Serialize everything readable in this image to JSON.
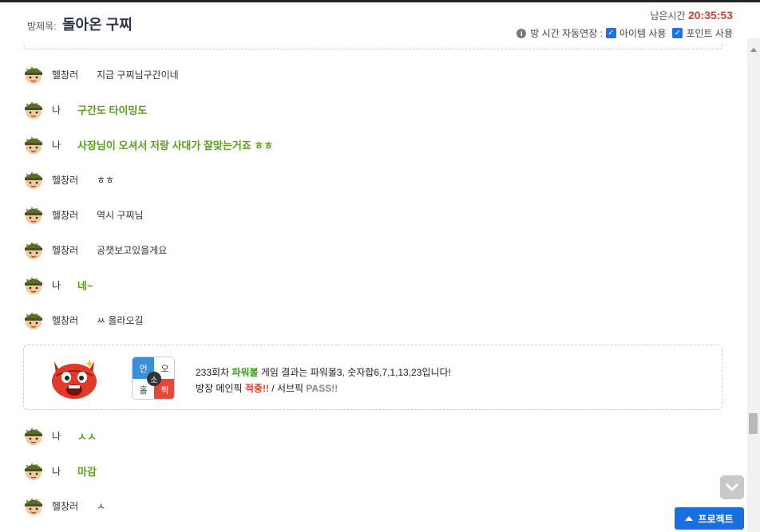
{
  "header": {
    "room_label": "방제목:",
    "room_title": "돌아온 구찌",
    "remaining_label": "남은시간",
    "remaining_time": "20:35:53",
    "auto_extend_label": "방 시간 자동연장 :",
    "item_use_label": "아이템 사용",
    "point_use_label": "포인트 사용",
    "item_use_checked": true,
    "point_use_checked": true
  },
  "messages": [
    {
      "nick": "헬창러",
      "text": "지금 구찌님구간이네",
      "mine": false
    },
    {
      "nick": "나",
      "text": "구간도 타이밍도",
      "mine": true
    },
    {
      "nick": "나",
      "text": "사장님이 오셔서 저랑 사대가 잘맞는거죠 ㅎㅎ",
      "mine": true
    },
    {
      "nick": "헬창러",
      "text": "ㅎㅎ",
      "mine": false
    },
    {
      "nick": "헬창러",
      "text": "역시 구찌님",
      "mine": false
    },
    {
      "nick": "헬창러",
      "text": "공챗보고있을게요",
      "mine": false
    },
    {
      "nick": "나",
      "text": "네~",
      "mine": true
    },
    {
      "nick": "헬창러",
      "text": "ㅆ 올라오길",
      "mine": false
    }
  ],
  "result": {
    "board": {
      "q1": "언",
      "q2": "오",
      "q3": "홀",
      "q4": "짝",
      "center": "소"
    },
    "line1_prefix": "233회차 ",
    "line1_game": "파워볼",
    "line1_suffix": " 게임 결과는 파워볼3, 숫자합6,7,1,13,23입니다!",
    "line2_prefix": "방장 메인픽 ",
    "line2_main_result": "적중!!",
    "line2_mid": " / 서브픽 ",
    "line2_sub_result": "PASS!!"
  },
  "messages_after": [
    {
      "nick": "나",
      "text": "ㅅㅅ",
      "mine": true
    },
    {
      "nick": "나",
      "text": "마감",
      "mine": true
    },
    {
      "nick": "헬창러",
      "text": "ㅅ",
      "mine": false
    }
  ],
  "buttons": {
    "project_label": "프로젝트"
  }
}
